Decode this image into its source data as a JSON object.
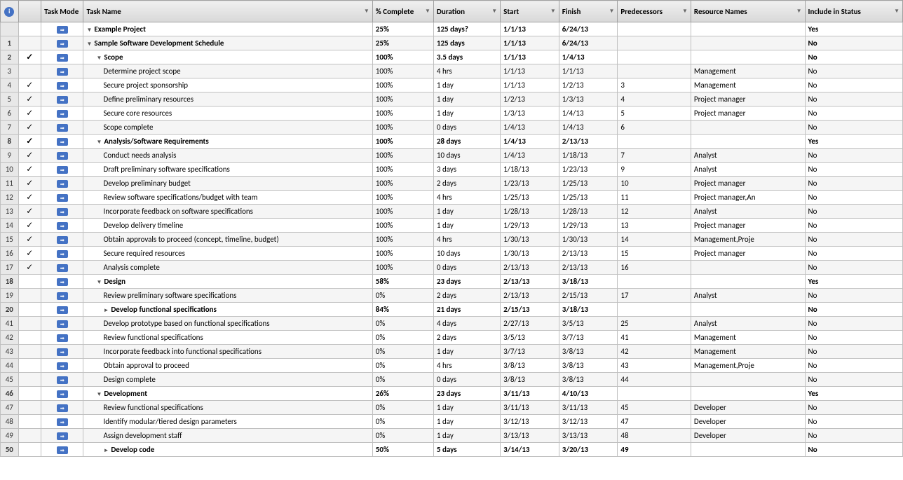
{
  "headers": {
    "row_num": "#",
    "info": "i",
    "task_mode": "Task Mode",
    "task_name": "Task Name",
    "pct_complete": "% Complete",
    "duration": "Duration",
    "start": "Start",
    "finish": "Finish",
    "predecessors": "Predecessors",
    "resource_names": "Resource Names",
    "include_in_status": "Include in Status"
  },
  "rows": [
    {
      "id": "",
      "check": "",
      "mode": "auto",
      "indent": 0,
      "collapse": "▼",
      "bold": true,
      "name": "Example Project",
      "pct": "25%",
      "duration": "125 days?",
      "start": "1/1/13",
      "finish": "6/24/13",
      "pred": "",
      "resources": "",
      "include": "Yes"
    },
    {
      "id": "1",
      "check": "",
      "mode": "auto",
      "indent": 1,
      "collapse": "▼",
      "bold": true,
      "name": "Sample Software Development Schedule",
      "pct": "25%",
      "duration": "125 days",
      "start": "1/1/13",
      "finish": "6/24/13",
      "pred": "",
      "resources": "",
      "include": "No"
    },
    {
      "id": "2",
      "check": "✓",
      "mode": "auto",
      "indent": 2,
      "collapse": "▼",
      "bold": true,
      "name": "Scope",
      "pct": "100%",
      "duration": "3.5 days",
      "start": "1/1/13",
      "finish": "1/4/13",
      "pred": "",
      "resources": "",
      "include": "No"
    },
    {
      "id": "3",
      "check": "",
      "mode": "auto",
      "indent": 3,
      "collapse": "",
      "bold": false,
      "name": "Determine project scope",
      "pct": "100%",
      "duration": "4 hrs",
      "start": "1/1/13",
      "finish": "1/1/13",
      "pred": "",
      "resources": "Management",
      "include": "No"
    },
    {
      "id": "4",
      "check": "✓",
      "mode": "auto",
      "indent": 3,
      "collapse": "",
      "bold": false,
      "name": "Secure project sponsorship",
      "pct": "100%",
      "duration": "1 day",
      "start": "1/1/13",
      "finish": "1/2/13",
      "pred": "3",
      "resources": "Management",
      "include": "No"
    },
    {
      "id": "5",
      "check": "✓",
      "mode": "auto",
      "indent": 3,
      "collapse": "",
      "bold": false,
      "name": "Define preliminary resources",
      "pct": "100%",
      "duration": "1 day",
      "start": "1/2/13",
      "finish": "1/3/13",
      "pred": "4",
      "resources": "Project manager",
      "include": "No"
    },
    {
      "id": "6",
      "check": "✓",
      "mode": "auto",
      "indent": 3,
      "collapse": "",
      "bold": false,
      "name": "Secure core resources",
      "pct": "100%",
      "duration": "1 day",
      "start": "1/3/13",
      "finish": "1/4/13",
      "pred": "5",
      "resources": "Project manager",
      "include": "No"
    },
    {
      "id": "7",
      "check": "✓",
      "mode": "auto",
      "indent": 3,
      "collapse": "",
      "bold": false,
      "name": "Scope complete",
      "pct": "100%",
      "duration": "0 days",
      "start": "1/4/13",
      "finish": "1/4/13",
      "pred": "6",
      "resources": "",
      "include": "No"
    },
    {
      "id": "8",
      "check": "✓",
      "mode": "auto",
      "indent": 2,
      "collapse": "▼",
      "bold": true,
      "name": "Analysis/Software Requirements",
      "pct": "100%",
      "duration": "28 days",
      "start": "1/4/13",
      "finish": "2/13/13",
      "pred": "",
      "resources": "",
      "include": "Yes"
    },
    {
      "id": "9",
      "check": "✓",
      "mode": "auto",
      "indent": 3,
      "collapse": "",
      "bold": false,
      "name": "Conduct needs analysis",
      "pct": "100%",
      "duration": "10 days",
      "start": "1/4/13",
      "finish": "1/18/13",
      "pred": "7",
      "resources": "Analyst",
      "include": "No"
    },
    {
      "id": "10",
      "check": "✓",
      "mode": "auto",
      "indent": 3,
      "collapse": "",
      "bold": false,
      "name": "Draft preliminary software specifications",
      "pct": "100%",
      "duration": "3 days",
      "start": "1/18/13",
      "finish": "1/23/13",
      "pred": "9",
      "resources": "Analyst",
      "include": "No"
    },
    {
      "id": "11",
      "check": "✓",
      "mode": "auto",
      "indent": 3,
      "collapse": "",
      "bold": false,
      "name": "Develop preliminary budget",
      "pct": "100%",
      "duration": "2 days",
      "start": "1/23/13",
      "finish": "1/25/13",
      "pred": "10",
      "resources": "Project manager",
      "include": "No"
    },
    {
      "id": "12",
      "check": "✓",
      "mode": "auto",
      "indent": 3,
      "collapse": "",
      "bold": false,
      "name": "Review software specifications/budget with team",
      "pct": "100%",
      "duration": "4 hrs",
      "start": "1/25/13",
      "finish": "1/25/13",
      "pred": "11",
      "resources": "Project manager,An",
      "include": "No"
    },
    {
      "id": "13",
      "check": "✓",
      "mode": "auto",
      "indent": 3,
      "collapse": "",
      "bold": false,
      "name": "Incorporate feedback on software specifications",
      "pct": "100%",
      "duration": "1 day",
      "start": "1/28/13",
      "finish": "1/28/13",
      "pred": "12",
      "resources": "Analyst",
      "include": "No"
    },
    {
      "id": "14",
      "check": "✓",
      "mode": "auto",
      "indent": 3,
      "collapse": "",
      "bold": false,
      "name": "Develop delivery timeline",
      "pct": "100%",
      "duration": "1 day",
      "start": "1/29/13",
      "finish": "1/29/13",
      "pred": "13",
      "resources": "Project manager",
      "include": "No"
    },
    {
      "id": "15",
      "check": "✓",
      "mode": "auto",
      "indent": 3,
      "collapse": "",
      "bold": false,
      "name": "Obtain approvals to proceed (concept, timeline, budget)",
      "pct": "100%",
      "duration": "4 hrs",
      "start": "1/30/13",
      "finish": "1/30/13",
      "pred": "14",
      "resources": "Management,Proje",
      "include": "No"
    },
    {
      "id": "16",
      "check": "✓",
      "mode": "auto",
      "indent": 3,
      "collapse": "",
      "bold": false,
      "name": "Secure required resources",
      "pct": "100%",
      "duration": "10 days",
      "start": "1/30/13",
      "finish": "2/13/13",
      "pred": "15",
      "resources": "Project manager",
      "include": "No"
    },
    {
      "id": "17",
      "check": "✓",
      "mode": "auto",
      "indent": 3,
      "collapse": "",
      "bold": false,
      "name": "Analysis complete",
      "pct": "100%",
      "duration": "0 days",
      "start": "2/13/13",
      "finish": "2/13/13",
      "pred": "16",
      "resources": "",
      "include": "No"
    },
    {
      "id": "18",
      "check": "",
      "mode": "auto",
      "indent": 2,
      "collapse": "▼",
      "bold": true,
      "name": "Design",
      "pct": "58%",
      "duration": "23 days",
      "start": "2/13/13",
      "finish": "3/18/13",
      "pred": "",
      "resources": "",
      "include": "Yes"
    },
    {
      "id": "19",
      "check": "",
      "mode": "auto",
      "indent": 3,
      "collapse": "",
      "bold": false,
      "name": "Review preliminary software specifications",
      "pct": "0%",
      "duration": "2 days",
      "start": "2/13/13",
      "finish": "2/15/13",
      "pred": "17",
      "resources": "Analyst",
      "include": "No"
    },
    {
      "id": "20",
      "check": "",
      "mode": "auto",
      "indent": 3,
      "collapse": "►",
      "bold": true,
      "name": "Develop functional specifications",
      "pct": "84%",
      "duration": "21 days",
      "start": "2/15/13",
      "finish": "3/18/13",
      "pred": "",
      "resources": "",
      "include": "No"
    },
    {
      "id": "41",
      "check": "",
      "mode": "auto",
      "indent": 3,
      "collapse": "",
      "bold": false,
      "name": "Develop prototype based on functional specifications",
      "pct": "0%",
      "duration": "4 days",
      "start": "2/27/13",
      "finish": "3/5/13",
      "pred": "25",
      "resources": "Analyst",
      "include": "No"
    },
    {
      "id": "42",
      "check": "",
      "mode": "auto",
      "indent": 3,
      "collapse": "",
      "bold": false,
      "name": "Review functional specifications",
      "pct": "0%",
      "duration": "2 days",
      "start": "3/5/13",
      "finish": "3/7/13",
      "pred": "41",
      "resources": "Management",
      "include": "No"
    },
    {
      "id": "43",
      "check": "",
      "mode": "auto",
      "indent": 3,
      "collapse": "",
      "bold": false,
      "name": "Incorporate feedback into functional specifications",
      "pct": "0%",
      "duration": "1 day",
      "start": "3/7/13",
      "finish": "3/8/13",
      "pred": "42",
      "resources": "Management",
      "include": "No"
    },
    {
      "id": "44",
      "check": "",
      "mode": "auto",
      "indent": 3,
      "collapse": "",
      "bold": false,
      "name": "Obtain approval to proceed",
      "pct": "0%",
      "duration": "4 hrs",
      "start": "3/8/13",
      "finish": "3/8/13",
      "pred": "43",
      "resources": "Management,Proje",
      "include": "No"
    },
    {
      "id": "45",
      "check": "",
      "mode": "auto",
      "indent": 3,
      "collapse": "",
      "bold": false,
      "name": "Design complete",
      "pct": "0%",
      "duration": "0 days",
      "start": "3/8/13",
      "finish": "3/8/13",
      "pred": "44",
      "resources": "",
      "include": "No"
    },
    {
      "id": "46",
      "check": "",
      "mode": "auto",
      "indent": 2,
      "collapse": "▼",
      "bold": true,
      "name": "Development",
      "pct": "26%",
      "duration": "23 days",
      "start": "3/11/13",
      "finish": "4/10/13",
      "pred": "",
      "resources": "",
      "include": "Yes"
    },
    {
      "id": "47",
      "check": "",
      "mode": "auto",
      "indent": 3,
      "collapse": "",
      "bold": false,
      "name": "Review functional specifications",
      "pct": "0%",
      "duration": "1 day",
      "start": "3/11/13",
      "finish": "3/11/13",
      "pred": "45",
      "resources": "Developer",
      "include": "No"
    },
    {
      "id": "48",
      "check": "",
      "mode": "auto",
      "indent": 3,
      "collapse": "",
      "bold": false,
      "name": "Identify modular/tiered design parameters",
      "pct": "0%",
      "duration": "1 day",
      "start": "3/12/13",
      "finish": "3/12/13",
      "pred": "47",
      "resources": "Developer",
      "include": "No"
    },
    {
      "id": "49",
      "check": "",
      "mode": "auto",
      "indent": 3,
      "collapse": "",
      "bold": false,
      "name": "Assign development staff",
      "pct": "0%",
      "duration": "1 day",
      "start": "3/13/13",
      "finish": "3/13/13",
      "pred": "48",
      "resources": "Developer",
      "include": "No"
    },
    {
      "id": "50",
      "check": "",
      "mode": "auto",
      "indent": 3,
      "collapse": "►",
      "bold": true,
      "name": "Develop code",
      "pct": "50%",
      "duration": "5 days",
      "start": "3/14/13",
      "finish": "3/20/13",
      "pred": "49",
      "resources": "",
      "include": "No"
    }
  ]
}
